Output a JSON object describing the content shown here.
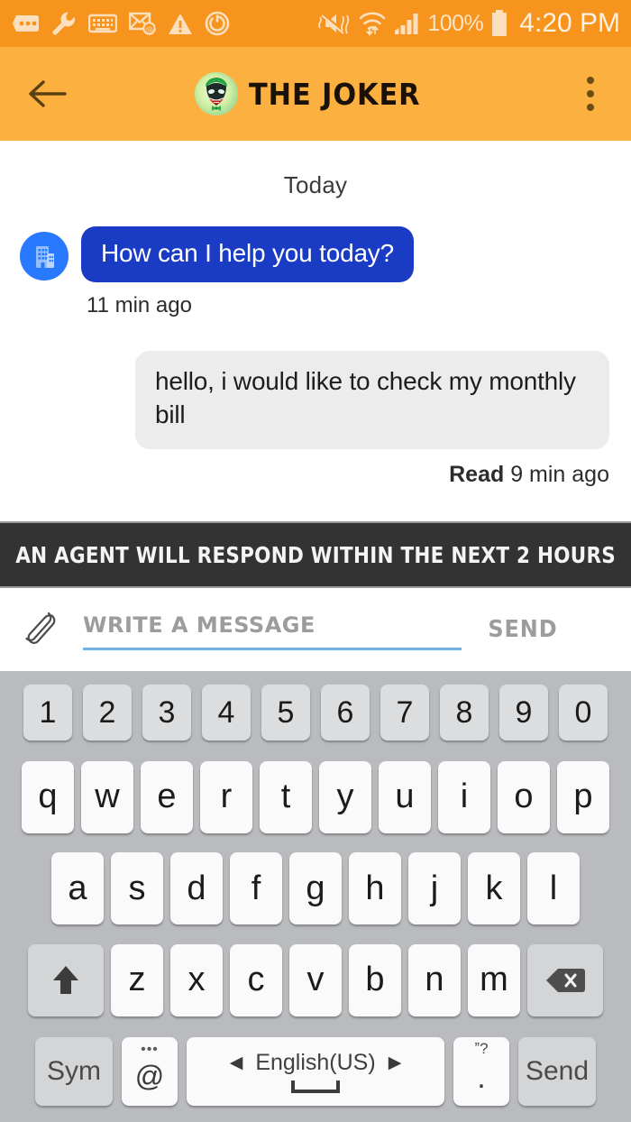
{
  "status_bar": {
    "icons": [
      "more-messages-icon",
      "wrench-icon",
      "keyboard-icon",
      "email-at-icon",
      "warning-triangle-icon",
      "power-sync-icon",
      "mute-vibrate-icon",
      "wifi-transfer-icon",
      "signal-bars-icon"
    ],
    "battery_percent": "100%",
    "battery_icon": "battery-full-icon",
    "time": "4:20 PM",
    "background_color": "#F7941E"
  },
  "app_bar": {
    "back_icon": "back-arrow-icon",
    "avatar_alt": "joker-avatar",
    "title": "THE JOKER",
    "overflow_icon": "overflow-menu-icon",
    "background_color": "#FBB040"
  },
  "chat": {
    "day_separator": "Today",
    "messages": [
      {
        "side": "in",
        "avatar_icon": "company-building-icon",
        "text": "How can I help you today?",
        "meta": "11 min ago",
        "bubble_color": "#1A3BC4"
      },
      {
        "side": "out",
        "text": "hello, i would like to check my monthly bill",
        "meta_status": "Read",
        "meta_time": "9 min ago",
        "bubble_color": "#ECECEC"
      }
    ]
  },
  "notice": {
    "text": "AN AGENT WILL RESPOND WITHIN THE NEXT  2 HOURS",
    "background_color": "#333333"
  },
  "composer": {
    "attach_icon": "paperclip-icon",
    "input_value": "",
    "input_placeholder": "WRITE A MESSAGE",
    "send_label": "SEND",
    "underline_color": "#6FB3E8"
  },
  "keyboard": {
    "background_color": "#B9BBBE",
    "number_row": [
      "1",
      "2",
      "3",
      "4",
      "5",
      "6",
      "7",
      "8",
      "9",
      "0"
    ],
    "row_q": [
      "q",
      "w",
      "e",
      "r",
      "t",
      "y",
      "u",
      "i",
      "o",
      "p"
    ],
    "row_a": [
      "a",
      "s",
      "d",
      "f",
      "g",
      "h",
      "j",
      "k",
      "l"
    ],
    "row_z": [
      "z",
      "x",
      "c",
      "v",
      "b",
      "n",
      "m"
    ],
    "shift_icon": "shift-up-arrow-icon",
    "backspace_icon": "backspace-delete-icon",
    "sym_label": "Sym",
    "at_label": "@",
    "at_dots": "•••",
    "space_language": "English(US)",
    "space_arrow_left": "◀",
    "space_arrow_right": "▶",
    "period_label": ".",
    "period_sup": "ˮ?",
    "send_key_label": "Send"
  }
}
